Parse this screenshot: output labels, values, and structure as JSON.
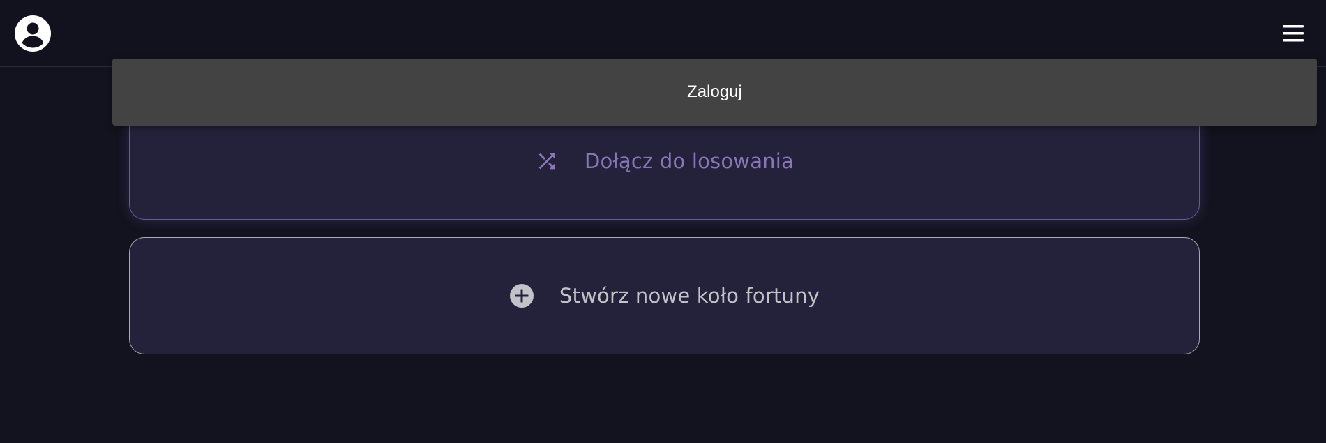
{
  "header": {
    "avatar_icon": "account-circle-icon",
    "menu_icon": "hamburger-menu-icon"
  },
  "popup": {
    "login_label": "Zaloguj"
  },
  "cards": {
    "join": {
      "label": "Dołącz do losowania",
      "icon": "shuffle-icon",
      "accent_color": "#8a76b7"
    },
    "create": {
      "label": "Stwórz nowe koło fortuny",
      "icon": "add-circle-icon",
      "accent_color": "#c2c2c8"
    }
  },
  "colors": {
    "background": "#13131f",
    "card_background": "#23223a",
    "popup_background": "#434343"
  }
}
